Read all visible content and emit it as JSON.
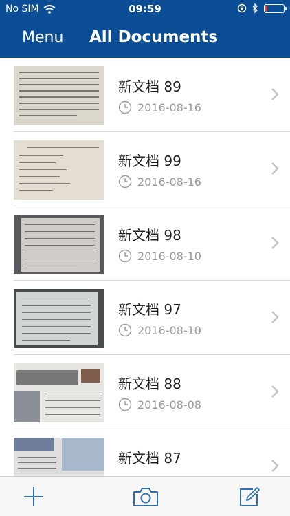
{
  "status_bar": {
    "carrier": "No SIM",
    "time": "09:59",
    "battery_level": 0.12,
    "battery_color": "#ff3b30"
  },
  "nav": {
    "menu_label": "Menu",
    "title": "All Documents",
    "color": "#0b4e95"
  },
  "documents": [
    {
      "title": "新文档 89",
      "date": "2016-08-16"
    },
    {
      "title": "新文档 99",
      "date": "2016-08-16"
    },
    {
      "title": "新文档 98",
      "date": "2016-08-10"
    },
    {
      "title": "新文档 97",
      "date": "2016-08-10"
    },
    {
      "title": "新文档 88",
      "date": "2016-08-08"
    },
    {
      "title": "新文档 87",
      "date": ""
    }
  ],
  "toolbar": {
    "icons": [
      "plus-icon",
      "camera-icon",
      "compose-icon"
    ],
    "tint": "#2f6fb4"
  }
}
